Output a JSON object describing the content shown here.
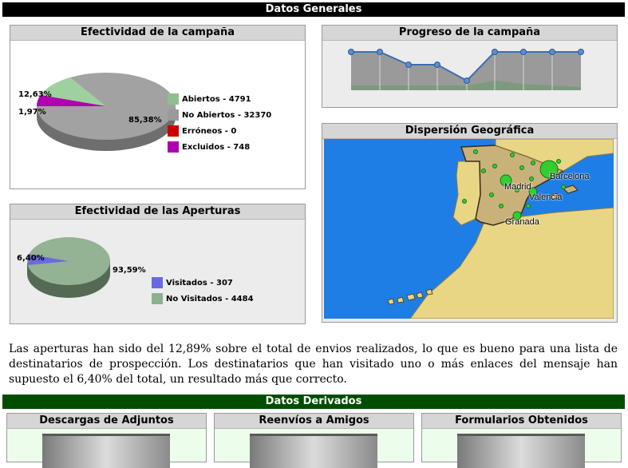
{
  "header": {
    "title": "Datos Generales"
  },
  "campaign_effectiveness": {
    "title": "Efectividad de la campaña",
    "labels": [
      "12,63%",
      "1,97%",
      "85,38%"
    ],
    "legend": [
      {
        "label": "Abiertos - 4791",
        "color": "#8fbf8f"
      },
      {
        "label": "No Abiertos - 32370",
        "color": "#9a9a9a"
      },
      {
        "label": "Erróneos - 0",
        "color": "#cc0000"
      },
      {
        "label": "Excluidos - 748",
        "color": "#b000b0"
      }
    ]
  },
  "progress": {
    "title": "Progreso de la campaña"
  },
  "opens_effectiveness": {
    "title": "Efectividad de las Aperturas",
    "labels": [
      "6,40%",
      "93,59%"
    ],
    "legend": [
      {
        "label": "Visitados - 307",
        "color": "#6a6ae0"
      },
      {
        "label": "No Visitados - 4484",
        "color": "#8fb08f"
      }
    ]
  },
  "geo": {
    "title": "Dispersión Geográfica",
    "cities": [
      "Madrid",
      "Barcelona",
      "Valencia",
      "Granada"
    ]
  },
  "summary": "Las aperturas han sido del 12,89% sobre el total de envios realizados, lo que es bueno para una lista de destinatarios de prospección. Los destinatarios que han visitado uno o más enlaces del mensaje han supuesto el 6,40% del total, un resultado más que correcto.",
  "derived": {
    "title": "Datos Derivados",
    "panels": [
      "Descargas de Adjuntos",
      "Reenvíos a Amigos",
      "Formularios Obtenidos"
    ]
  }
}
